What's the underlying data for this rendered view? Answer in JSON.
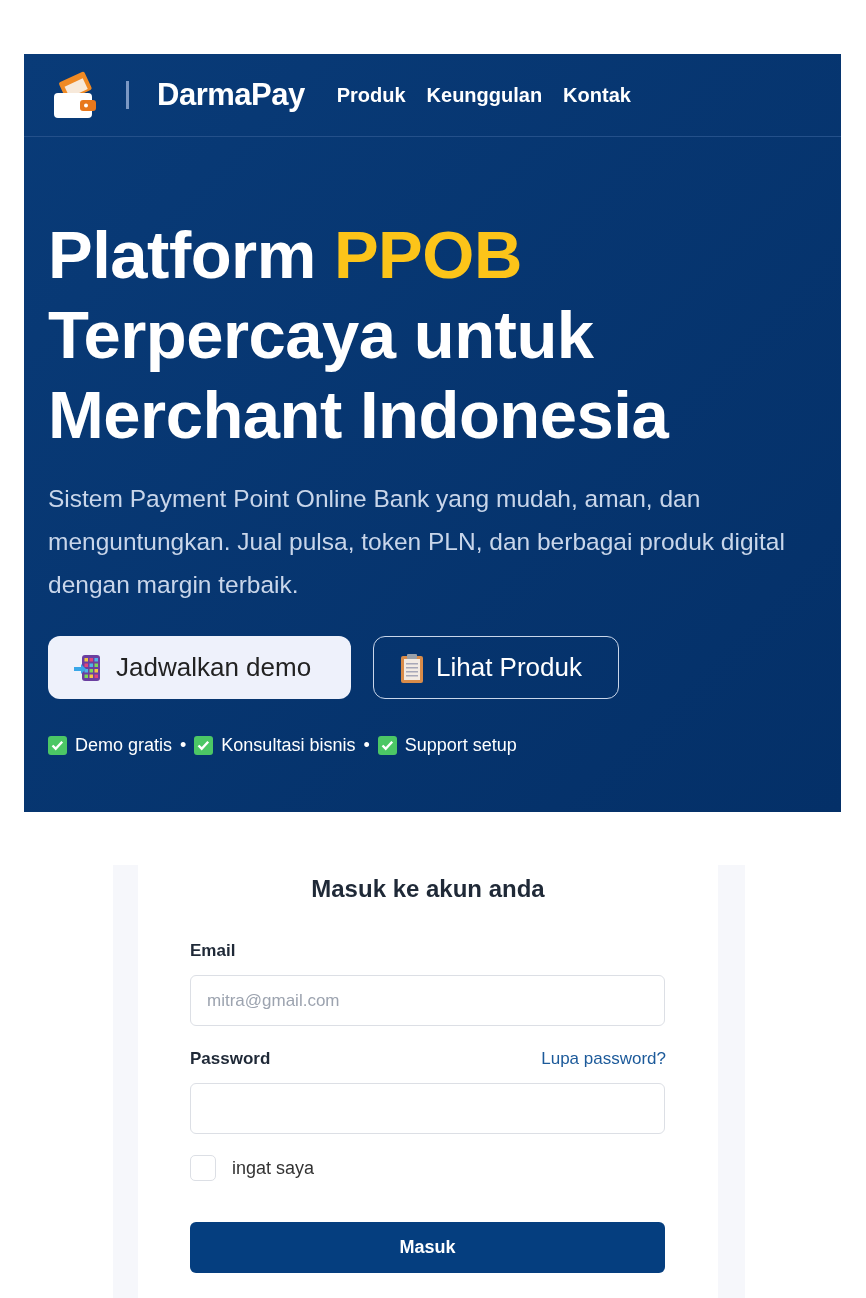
{
  "navbar": {
    "brand": "DarmaPay",
    "links": [
      {
        "label": "Produk"
      },
      {
        "label": "Keunggulan"
      },
      {
        "label": "Kontak"
      }
    ]
  },
  "hero": {
    "headline": [
      {
        "text": "Platform ",
        "highlight": false
      },
      {
        "text": "PPOB",
        "highlight": true
      },
      {
        "text": " Terpercaya untuk Merchant Indonesia",
        "highlight": false
      }
    ],
    "description": "Sistem Payment Point Online Bank yang mudah, aman, dan menguntungkan. Jual pulsa, token PLN, dan berbagai produk digital dengan margin terbaik.",
    "buttons": [
      {
        "label": "Jadwalkan demo",
        "kind": "primary"
      },
      {
        "label": "Lihat Produk",
        "kind": "outline"
      }
    ],
    "perks": [
      {
        "label": "Demo gratis"
      },
      {
        "label": "Konsultasi bisnis"
      },
      {
        "label": "Support setup"
      }
    ],
    "separator": "•"
  },
  "login": {
    "title": "Masuk ke akun anda",
    "fields": [
      {
        "label": "Email",
        "placeholder": "mitra@gmail.com"
      },
      {
        "label": "Password",
        "link": "Lupa password?"
      }
    ],
    "remember": {
      "label": "ingat saya",
      "checked": false
    },
    "submit": "Masuk"
  }
}
